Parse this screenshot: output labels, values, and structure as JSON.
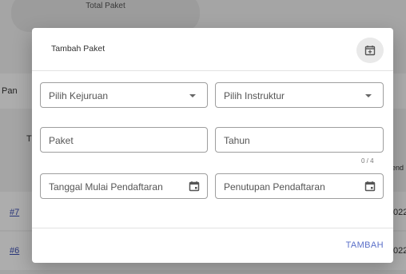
{
  "background": {
    "card_label": "Total Paket",
    "tab_label": "Pan",
    "col_label": "Ti",
    "right_col_label": "end",
    "rows": [
      {
        "id": "#7",
        "year": "022"
      },
      {
        "id": "#6",
        "year": "022"
      }
    ]
  },
  "dialog": {
    "title": "Tambah Paket",
    "fields": {
      "kejuruan": "Pilih Kejuruan",
      "instruktur": "Pilih Instruktur",
      "paket": "Paket",
      "tahun": "Tahun",
      "tahun_counter": "0 / 4",
      "tanggal_mulai": "Tanggal Mulai Pendaftaran",
      "penutupan": "Penutupan Pendaftaran"
    },
    "submit_label": "TAMBAH"
  },
  "colors": {
    "accent": "#5a6fc8",
    "overlay": "rgba(0,0,0,0.32)"
  }
}
